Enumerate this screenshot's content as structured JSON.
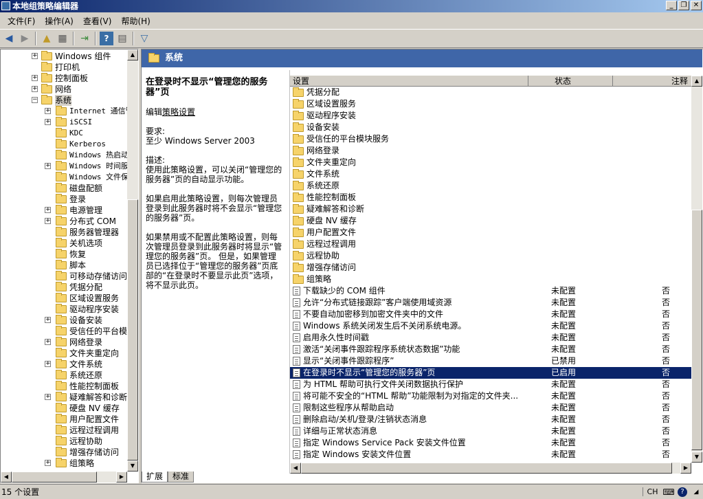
{
  "window": {
    "title": "本地组策略编辑器",
    "buttons": {
      "minimize": "_",
      "restore": "❐",
      "close": "✕"
    }
  },
  "menu": [
    {
      "label": "文件(F)"
    },
    {
      "label": "操作(A)"
    },
    {
      "label": "查看(V)"
    },
    {
      "label": "帮助(H)"
    }
  ],
  "tree": [
    {
      "label": "Windows 组件",
      "level": 2,
      "expander": "+",
      "mono": false
    },
    {
      "label": "打印机",
      "level": 2,
      "expander": "",
      "mono": false
    },
    {
      "label": "控制面板",
      "level": 2,
      "expander": "+",
      "mono": false
    },
    {
      "label": "网络",
      "level": 2,
      "expander": "+",
      "mono": false
    },
    {
      "label": "系统",
      "level": 2,
      "expander": "−",
      "mono": false,
      "selected": true
    },
    {
      "label": "Internet 通信管",
      "level": 3,
      "expander": "+",
      "mono": true
    },
    {
      "label": "iSCSI",
      "level": 3,
      "expander": "+",
      "mono": true
    },
    {
      "label": "KDC",
      "level": 3,
      "expander": "",
      "mono": true
    },
    {
      "label": "Kerberos",
      "level": 3,
      "expander": "",
      "mono": true
    },
    {
      "label": "Windows 热启动",
      "level": 3,
      "expander": "",
      "mono": true
    },
    {
      "label": "Windows 时间服",
      "level": 3,
      "expander": "+",
      "mono": true
    },
    {
      "label": "Windows 文件保",
      "level": 3,
      "expander": "",
      "mono": true
    },
    {
      "label": "磁盘配额",
      "level": 3,
      "expander": "",
      "mono": false
    },
    {
      "label": "登录",
      "level": 3,
      "expander": "",
      "mono": false
    },
    {
      "label": "电源管理",
      "level": 3,
      "expander": "+",
      "mono": false
    },
    {
      "label": "分布式 COM",
      "level": 3,
      "expander": "+",
      "mono": false
    },
    {
      "label": "服务器管理器",
      "level": 3,
      "expander": "",
      "mono": false
    },
    {
      "label": "关机选项",
      "level": 3,
      "expander": "",
      "mono": false
    },
    {
      "label": "恢复",
      "level": 3,
      "expander": "",
      "mono": false
    },
    {
      "label": "脚本",
      "level": 3,
      "expander": "",
      "mono": false
    },
    {
      "label": "可移动存储访问",
      "level": 3,
      "expander": "",
      "mono": false
    },
    {
      "label": "凭据分配",
      "level": 3,
      "expander": "",
      "mono": false
    },
    {
      "label": "区域设置服务",
      "level": 3,
      "expander": "",
      "mono": false
    },
    {
      "label": "驱动程序安装",
      "level": 3,
      "expander": "",
      "mono": false
    },
    {
      "label": "设备安装",
      "level": 3,
      "expander": "+",
      "mono": false
    },
    {
      "label": "受信任的平台模",
      "level": 3,
      "expander": "",
      "mono": false
    },
    {
      "label": "网络登录",
      "level": 3,
      "expander": "+",
      "mono": false
    },
    {
      "label": "文件夹重定向",
      "level": 3,
      "expander": "",
      "mono": false
    },
    {
      "label": "文件系统",
      "level": 3,
      "expander": "+",
      "mono": false
    },
    {
      "label": "系统还原",
      "level": 3,
      "expander": "",
      "mono": false
    },
    {
      "label": "性能控制面板",
      "level": 3,
      "expander": "",
      "mono": false
    },
    {
      "label": "疑难解答和诊断",
      "level": 3,
      "expander": "+",
      "mono": false
    },
    {
      "label": "硬盘 NV 缓存",
      "level": 3,
      "expander": "",
      "mono": false
    },
    {
      "label": "用户配置文件",
      "level": 3,
      "expander": "",
      "mono": false
    },
    {
      "label": "远程过程调用",
      "level": 3,
      "expander": "",
      "mono": false
    },
    {
      "label": "远程协助",
      "level": 3,
      "expander": "",
      "mono": false
    },
    {
      "label": "增强存储访问",
      "level": 3,
      "expander": "",
      "mono": false
    },
    {
      "label": "组策略",
      "level": 3,
      "expander": "+",
      "mono": false
    }
  ],
  "header": {
    "title": "系统"
  },
  "description": {
    "title": "在登录时不显示“管理您的服务器”页",
    "edit_prefix": "编辑",
    "edit_link": "策略设置",
    "req_label": "要求:",
    "req_value": "至少 Windows Server 2003",
    "desc_label": "描述:",
    "desc_value": "使用此策略设置，可以关闭“管理您的服务器”页的自动显示功能。",
    "para1": "如果启用此策略设置，则每次管理员登录到此服务器时将不会显示“管理您的服务器”页。",
    "para2": "如果禁用或不配置此策略设置，则每次管理员登录到此服务器时将显示“管理您的服务器”页。 但是，如果管理员已选择位于“管理您的服务器”页底部的“在登录时不要显示此页”选项，将不显示此页。"
  },
  "list": {
    "columns": {
      "setting": "设置",
      "state": "状态",
      "comment": "注释"
    },
    "folders": [
      "凭据分配",
      "区域设置服务",
      "驱动程序安装",
      "设备安装",
      "受信任的平台模块服务",
      "网络登录",
      "文件夹重定向",
      "文件系统",
      "系统还原",
      "性能控制面板",
      "疑难解答和诊断",
      "硬盘 NV 缓存",
      "用户配置文件",
      "远程过程调用",
      "远程协助",
      "增强存储访问",
      "组策略"
    ],
    "policies": [
      {
        "name": "下载缺少的 COM 组件",
        "state": "未配置",
        "comment": "否"
      },
      {
        "name": "允许“分布式链接跟踪”客户端使用域资源",
        "state": "未配置",
        "comment": "否"
      },
      {
        "name": "不要自动加密移到加密文件夹中的文件",
        "state": "未配置",
        "comment": "否"
      },
      {
        "name": "Windows 系统关闭发生后不关闭系统电源。",
        "state": "未配置",
        "comment": "否"
      },
      {
        "name": "启用永久性时间戳",
        "state": "未配置",
        "comment": "否"
      },
      {
        "name": "激活“关闭事件跟踪程序系统状态数据”功能",
        "state": "未配置",
        "comment": "否"
      },
      {
        "name": "显示“关闭事件跟踪程序”",
        "state": "已禁用",
        "comment": "否"
      },
      {
        "name": "在登录时不显示“管理您的服务器”页",
        "state": "已启用",
        "comment": "否",
        "selected": true
      },
      {
        "name": "为 HTML 帮助可执行文件关闭数据执行保护",
        "state": "未配置",
        "comment": "否"
      },
      {
        "name": "将可能不安全的“HTML 帮助”功能限制为对指定的文件夹...",
        "state": "未配置",
        "comment": "否"
      },
      {
        "name": "限制这些程序从帮助启动",
        "state": "未配置",
        "comment": "否"
      },
      {
        "name": "删除启动/关机/登录/注销状态消息",
        "state": "未配置",
        "comment": "否"
      },
      {
        "name": "详细与正常状态消息",
        "state": "未配置",
        "comment": "否"
      },
      {
        "name": "指定 Windows Service Pack 安装文件位置",
        "state": "未配置",
        "comment": "否"
      },
      {
        "name": "指定 Windows 安装文件位置",
        "state": "未配置",
        "comment": "否"
      }
    ]
  },
  "tabs": [
    "扩展",
    "标准"
  ],
  "status": {
    "text": "15 个设置",
    "lang": "CH"
  }
}
